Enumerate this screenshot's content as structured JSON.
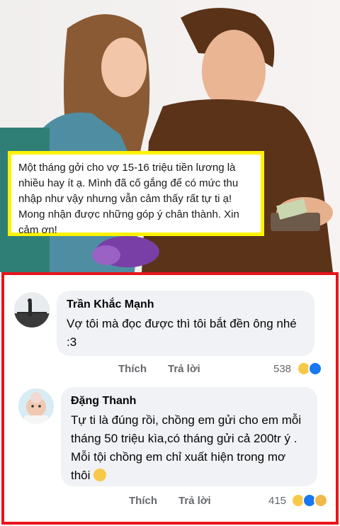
{
  "post": {
    "caption": "Một tháng gởi cho vợ 15-16 triệu tiền lương là nhiều hay ít ạ. Mình đã cố gắng để có mức thu nhập như vậy nhưng vẫn cảm thấy rất tự ti ạ! Mong nhận được những góp ý chân thành. Xin cảm ơn!"
  },
  "comments": [
    {
      "author": "Trần Khắc Mạnh",
      "text": "Vợ tôi mà đọc được thì tôi bắt đền ông nhé :3",
      "like_label": "Thích",
      "reply_label": "Trả lời",
      "reaction_count": "538",
      "reactions": [
        "haha-icon",
        "like-icon"
      ]
    },
    {
      "author": "Đặng Thanh",
      "text": "Tự ti là đúng rồi, chồng em gửi cho em mỗi tháng 50 triệu kìa,có tháng gửi cả 200tr ý . Mỗi tội chồng em chỉ xuất hiện trong mơ thôi",
      "like_label": "Thích",
      "reply_label": "Trả lời",
      "reaction_count": "415",
      "reactions": [
        "haha-icon",
        "like-icon",
        "sad-icon"
      ]
    }
  ],
  "colors": {
    "caption_border": "#fff200",
    "panel_border": "#e8141b",
    "bubble_bg": "#f0f2f5",
    "like_blue": "#1877f2"
  }
}
